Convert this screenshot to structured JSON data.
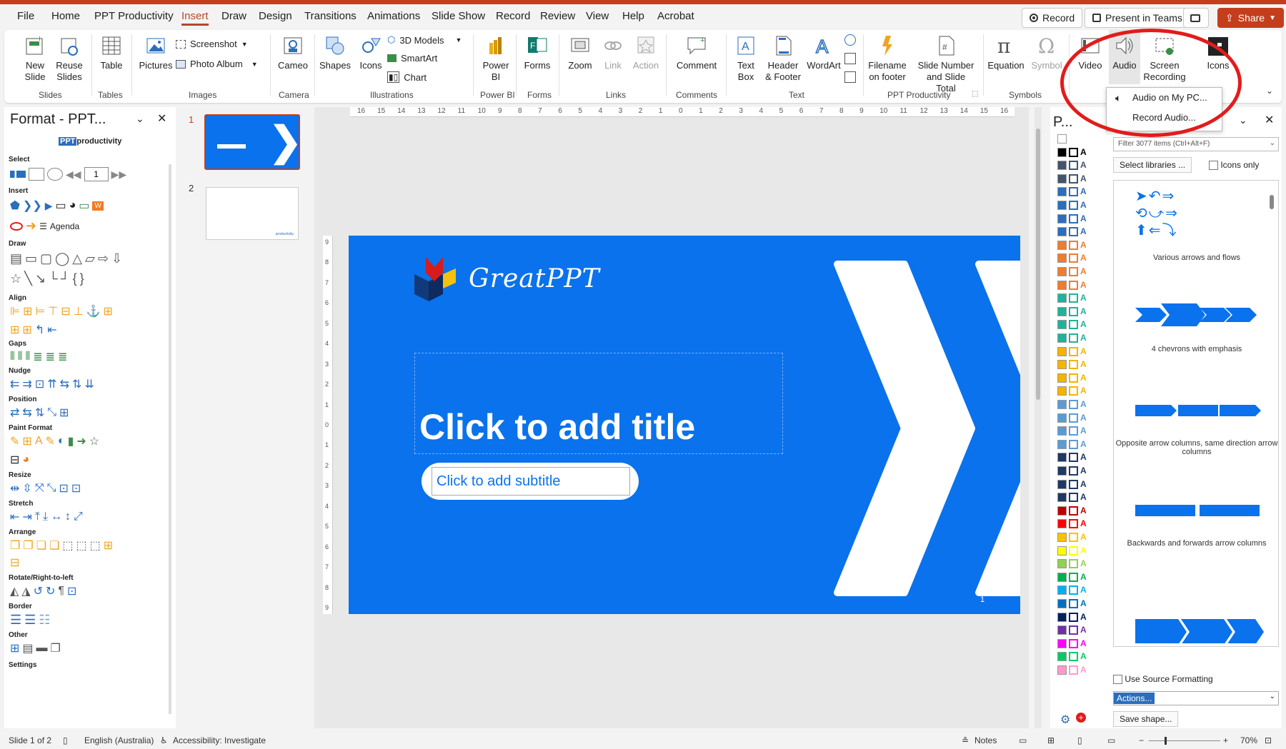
{
  "menu_tabs": [
    "File",
    "Home",
    "PPT Productivity",
    "Insert",
    "Draw",
    "Design",
    "Transitions",
    "Animations",
    "Slide Show",
    "Record",
    "Review",
    "View",
    "Help",
    "Acrobat"
  ],
  "active_tab": "Insert",
  "top_buttons": {
    "record": "Record",
    "present_in_teams": "Present in Teams",
    "share": "Share"
  },
  "ribbon": {
    "slides": {
      "new_slide": "New\nSlide",
      "reuse_slides": "Reuse\nSlides",
      "group": "Slides"
    },
    "tables": {
      "table": "Table",
      "group": "Tables"
    },
    "images": {
      "pictures": "Pictures",
      "screenshot": "Screenshot",
      "photo_album": "Photo Album",
      "group": "Images"
    },
    "camera": {
      "cameo": "Cameo",
      "group": "Camera"
    },
    "illustrations": {
      "shapes": "Shapes",
      "icons": "Icons",
      "models_3d": "3D Models",
      "smartart": "SmartArt",
      "chart": "Chart",
      "group": "Illustrations"
    },
    "powerbi": {
      "power_bi": "Power\nBI",
      "group": "Power BI"
    },
    "forms": {
      "forms": "Forms",
      "group": "Forms"
    },
    "links": {
      "zoom": "Zoom",
      "link": "Link",
      "action": "Action",
      "group": "Links"
    },
    "comments": {
      "comment": "Comment",
      "group": "Comments"
    },
    "text": {
      "text_box": "Text\nBox",
      "header_footer": "Header\n& Footer",
      "wordart": "WordArt",
      "group": "Text"
    },
    "pptp": {
      "filename_footer": "Filename\non footer",
      "slide_number": "Slide Number\nand Slide Total",
      "group": "PPT Productivity"
    },
    "symbols": {
      "equation": "Equation",
      "symbol": "Symbol",
      "group": "Symbols"
    },
    "media": {
      "video": "Video",
      "audio": "Audio",
      "screen_recording": "Screen\nRecording"
    },
    "icons_btn": "Icons"
  },
  "audio_menu": {
    "audio_on_pc": "Audio on My PC...",
    "record_audio": "Record Audio..."
  },
  "left_pane": {
    "title": "Format - PPT...",
    "logo_text": "productivity",
    "logo_prefix": "PPT",
    "sections": [
      "Select",
      "Insert",
      "Draw",
      "Align",
      "Gaps",
      "Nudge",
      "Position",
      "Paint Format",
      "Resize",
      "Stretch",
      "Arrange",
      "Rotate/Right-to-left",
      "Border",
      "Other",
      "Settings"
    ],
    "page_input": "1",
    "agenda": "Agenda"
  },
  "slides": [
    {
      "number": "1"
    },
    {
      "number": "2"
    }
  ],
  "slide": {
    "logo_text": "GreatPPT",
    "title_placeholder": "Click to add title",
    "subtitle_placeholder": "Click to add subtitle",
    "slide_number": "1",
    "bg_color": "#0a72ec"
  },
  "ruler_h": [
    "16",
    "15",
    "14",
    "13",
    "12",
    "11",
    "10",
    "9",
    "8",
    "7",
    "6",
    "5",
    "4",
    "3",
    "2",
    "1",
    "0",
    "1",
    "2",
    "3",
    "4",
    "5",
    "6",
    "7",
    "8",
    "9",
    "10",
    "11",
    "12",
    "13",
    "14",
    "15",
    "16"
  ],
  "ruler_v": [
    "9",
    "8",
    "7",
    "6",
    "5",
    "4",
    "3",
    "2",
    "1",
    "0",
    "1",
    "2",
    "3",
    "4",
    "5",
    "6",
    "7",
    "8",
    "9"
  ],
  "right_pane": {
    "title": "P...",
    "filter_placeholder": "Filter 3077 items (Ctrl+Alt+F)",
    "select_libraries": "Select libraries ...",
    "icons_only": "Icons only",
    "library_items": [
      "Various arrows and flows",
      "4 chevrons with emphasis",
      "Opposite arrow columns, same direction arrow columns",
      "Backwards and forwards arrow columns"
    ],
    "use_source_formatting": "Use Source Formatting",
    "actions": "Actions...",
    "save_shape": "Save shape..."
  },
  "status": {
    "slide_info": "Slide 1 of 2",
    "language": "English (Australia)",
    "accessibility": "Accessibility: Investigate",
    "notes": "Notes",
    "zoom": "70%"
  },
  "colors": {
    "accent": "#c43e1c",
    "brand_blue": "#0a72ec",
    "highlight_circle": "#e31b1b"
  }
}
